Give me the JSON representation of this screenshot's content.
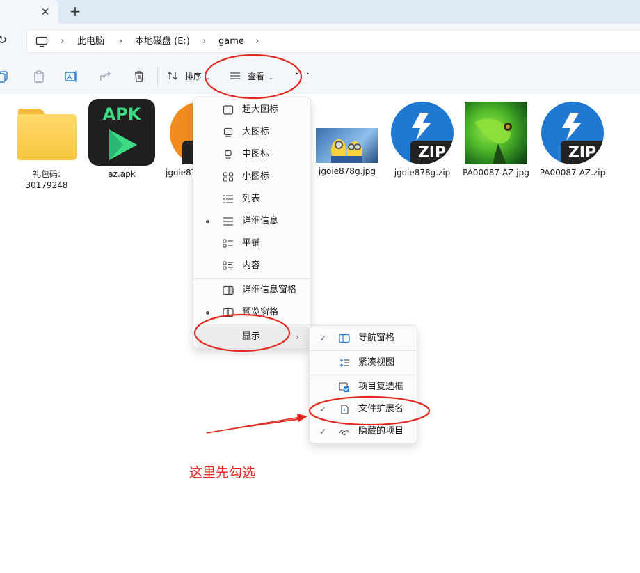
{
  "tabs": {
    "close_glyph": "✕",
    "new_glyph": "+"
  },
  "address": {
    "refresh_glyph": "↻",
    "crumbs": [
      "此电脑",
      "本地磁盘 (E:)",
      "game"
    ],
    "chevron": "›"
  },
  "toolbar": {
    "sort_label": "排序",
    "view_label": "查看",
    "dropdown_glyph": "⌄",
    "more_glyph": "· ·"
  },
  "files": [
    {
      "name_line1": "礼包码:",
      "name_line2": "30179248",
      "kind": "folder"
    },
    {
      "name": "az.apk",
      "kind": "apk",
      "badge": "APK"
    },
    {
      "name": "jgoie87",
      "kind": "zip-partial"
    },
    {
      "name": "jgoie878g.jpg",
      "kind": "photo-minion"
    },
    {
      "name": "jgoie878g.zip",
      "kind": "zip",
      "badge": "ZIP"
    },
    {
      "name": "PA00087-AZ.jpg",
      "kind": "photo-lizard"
    },
    {
      "name": "PA00087-AZ.zip",
      "kind": "zip",
      "badge": "ZIP"
    }
  ],
  "view_menu": {
    "items": [
      {
        "label": "超大图标",
        "icon": "extra-large-icons-icon",
        "selected": false
      },
      {
        "label": "大图标",
        "icon": "large-icons-icon",
        "selected": false
      },
      {
        "label": "中图标",
        "icon": "medium-icons-icon",
        "selected": false
      },
      {
        "label": "小图标",
        "icon": "small-icons-icon",
        "selected": false
      },
      {
        "label": "列表",
        "icon": "list-icon",
        "selected": false
      },
      {
        "label": "详细信息",
        "icon": "details-icon",
        "selected": true
      },
      {
        "label": "平铺",
        "icon": "tiles-icon",
        "selected": false
      },
      {
        "label": "内容",
        "icon": "content-icon",
        "selected": false
      }
    ],
    "panes": [
      {
        "label": "详细信息窗格",
        "icon": "details-pane-icon",
        "selected": false
      },
      {
        "label": "预览窗格",
        "icon": "preview-pane-icon",
        "selected": true
      }
    ],
    "show_label": "显示",
    "submenu_arrow": "›"
  },
  "show_submenu": {
    "check_glyph": "✓",
    "items": [
      {
        "label": "导航窗格",
        "icon": "navigation-pane-icon",
        "checked": true
      },
      {
        "label": "紧凑视图",
        "icon": "compact-view-icon",
        "checked": false
      },
      {
        "label": "项目复选框",
        "icon": "item-checkbox-icon",
        "checked": false
      },
      {
        "label": "文件扩展名",
        "icon": "file-extension-icon",
        "checked": true
      },
      {
        "label": "隐藏的项目",
        "icon": "hidden-items-icon",
        "checked": true
      }
    ]
  },
  "annotation": {
    "text": "这里先勾选",
    "color": "#e3281f"
  }
}
